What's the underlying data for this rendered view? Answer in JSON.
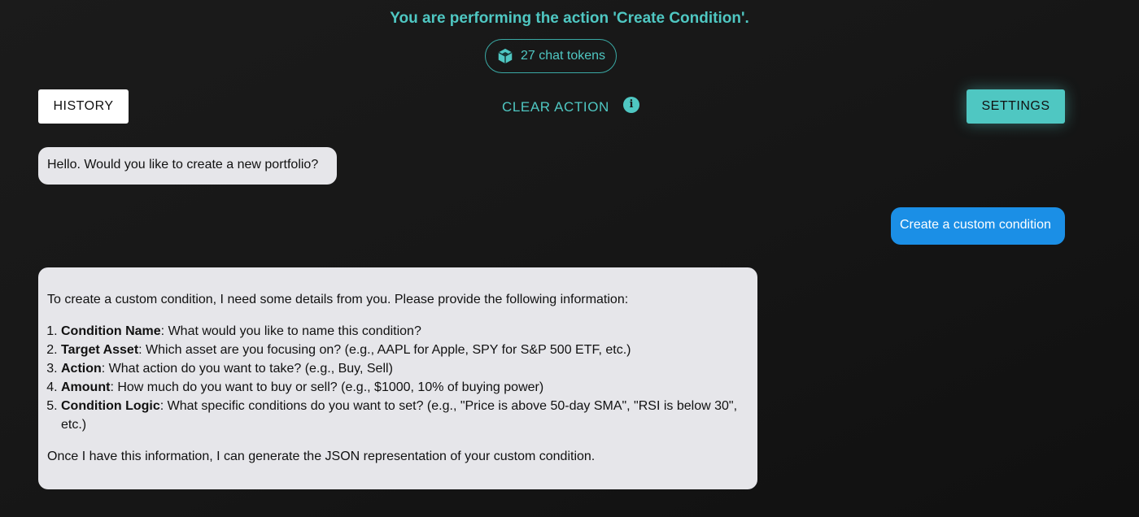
{
  "banner": "You are performing the action 'Create Condition'.",
  "tokens": {
    "icon": "cube-icon",
    "label": "27 chat tokens"
  },
  "toolbar": {
    "history_label": "HISTORY",
    "clear_action_label": "CLEAR ACTION",
    "info_icon": "info-icon",
    "settings_label": "SETTINGS"
  },
  "colors": {
    "accent": "#4fc7c2",
    "user_bubble": "#1b8fe6",
    "bot_bubble": "#e6e6ea",
    "background": "#181818"
  },
  "messages": [
    {
      "role": "assistant",
      "text": "Hello. Would you like to create a new portfolio?"
    },
    {
      "role": "user",
      "text": "Create a custom condition"
    },
    {
      "role": "assistant",
      "intro": "To create a custom condition, I need some details from you. Please provide the following information:",
      "items": [
        {
          "term": "Condition Name",
          "text": ": What would you like to name this condition?"
        },
        {
          "term": "Target Asset",
          "text": ": Which asset are you focusing on? (e.g., AAPL for Apple, SPY for S&P 500 ETF, etc.)"
        },
        {
          "term": "Action",
          "text": ": What action do you want to take? (e.g., Buy, Sell)"
        },
        {
          "term": "Amount",
          "text": ": How much do you want to buy or sell? (e.g., $1000, 10% of buying power)"
        },
        {
          "term": "Condition Logic",
          "text": ": What specific conditions do you want to set? (e.g., \"Price is above 50-day SMA\", \"RSI is below 30\", etc.)"
        }
      ],
      "outro": "Once I have this information, I can generate the JSON representation of your custom condition."
    }
  ]
}
